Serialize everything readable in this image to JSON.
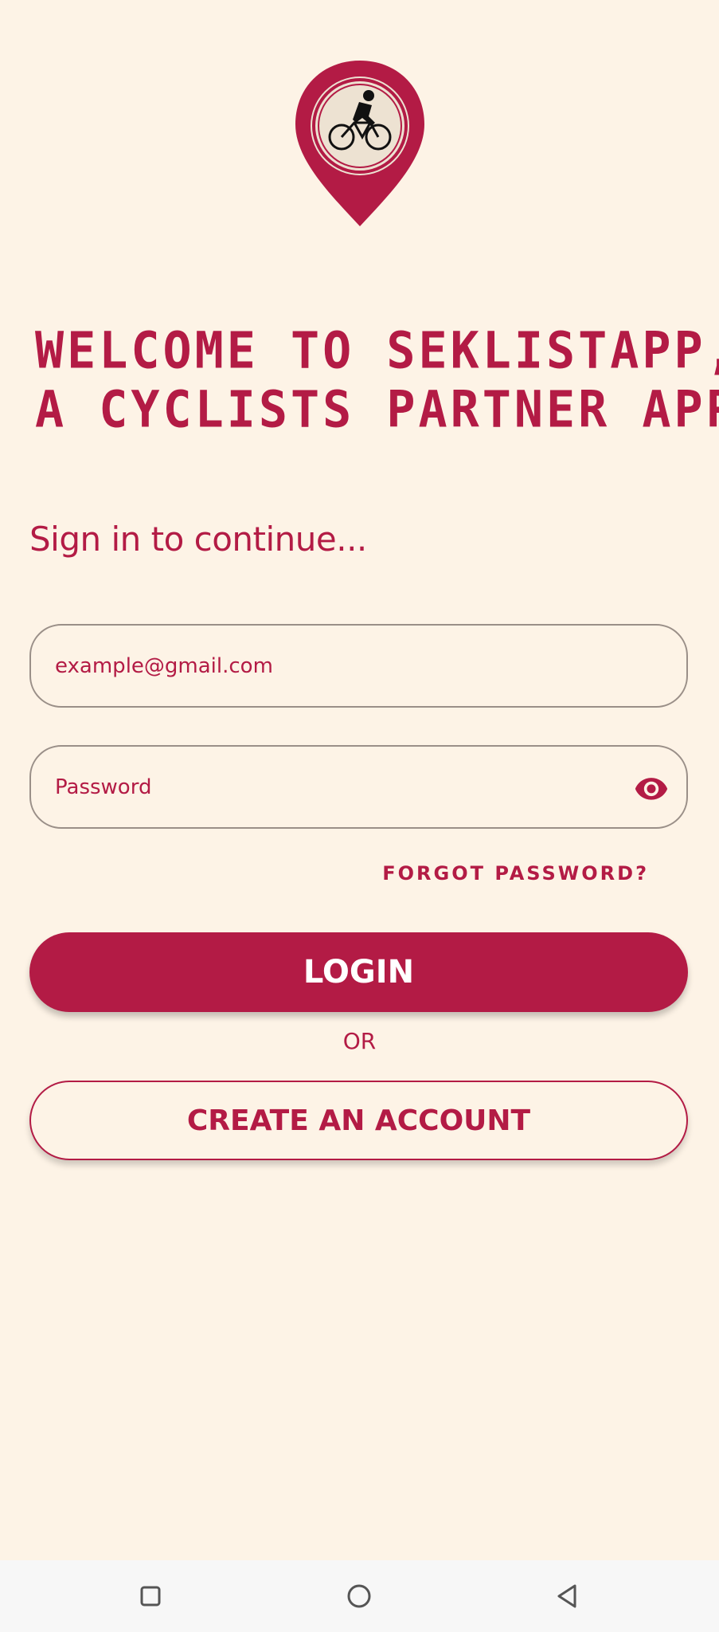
{
  "header": {
    "logo_icon": "map-pin-cyclist-icon",
    "welcome_line1": "WELCOME TO SEKLISTAPP,",
    "welcome_line2": "A CYCLISTS PARTNER APP"
  },
  "signin": {
    "subtitle": "Sign in to continue...",
    "email_placeholder": "example@gmail.com",
    "password_placeholder": "Password",
    "password_toggle_icon": "eye-icon",
    "forgot_label": "FORGOT PASSWORD?",
    "login_label": "LOGIN",
    "or_label": "OR",
    "create_label": "CREATE AN ACCOUNT"
  },
  "navbar": {
    "recent_icon": "square-icon",
    "home_icon": "circle-icon",
    "back_icon": "triangle-back-icon"
  },
  "colors": {
    "brand": "#b31b45",
    "background": "#fdf3e6",
    "navbar_bg": "#f7f7f7"
  }
}
